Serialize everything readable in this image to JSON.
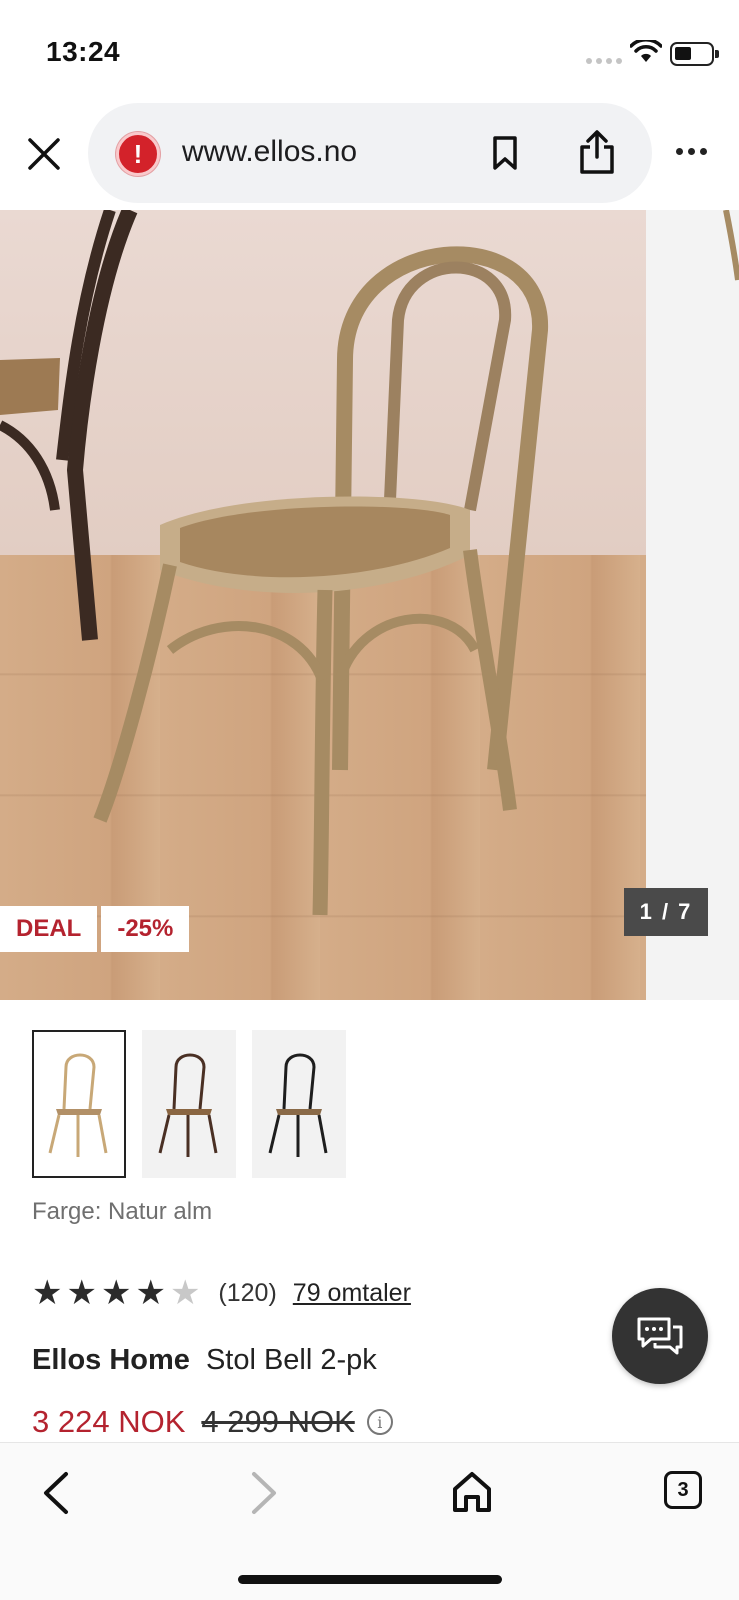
{
  "status_bar": {
    "time": "13:24"
  },
  "browser": {
    "url": "www.ellos.no",
    "close_icon": "close-icon",
    "security_icon": "warning-icon",
    "bookmark_icon": "bookmark-icon",
    "share_icon": "share-icon",
    "more_icon": "more-icon"
  },
  "product_image": {
    "badges": [
      "DEAL",
      "-25%"
    ],
    "pager": "1 / 7"
  },
  "thumbnails": [
    {
      "label": "natur-alm",
      "selected": true
    },
    {
      "label": "brown",
      "selected": false
    },
    {
      "label": "black",
      "selected": false
    }
  ],
  "color": {
    "label": "Farge: Natur alm"
  },
  "rating": {
    "stars": 4,
    "max_stars": 5,
    "count": "(120)",
    "reviews_link": "79 omtaler"
  },
  "product": {
    "brand": "Ellos Home",
    "name": "Stol Bell 2-pk",
    "price_now": "3 224 NOK",
    "price_old": "4 299 NOK"
  },
  "bottom_nav": {
    "tabs_count": "3"
  },
  "colors": {
    "accent_red": "#b4232f",
    "chat_button": "#333333"
  }
}
